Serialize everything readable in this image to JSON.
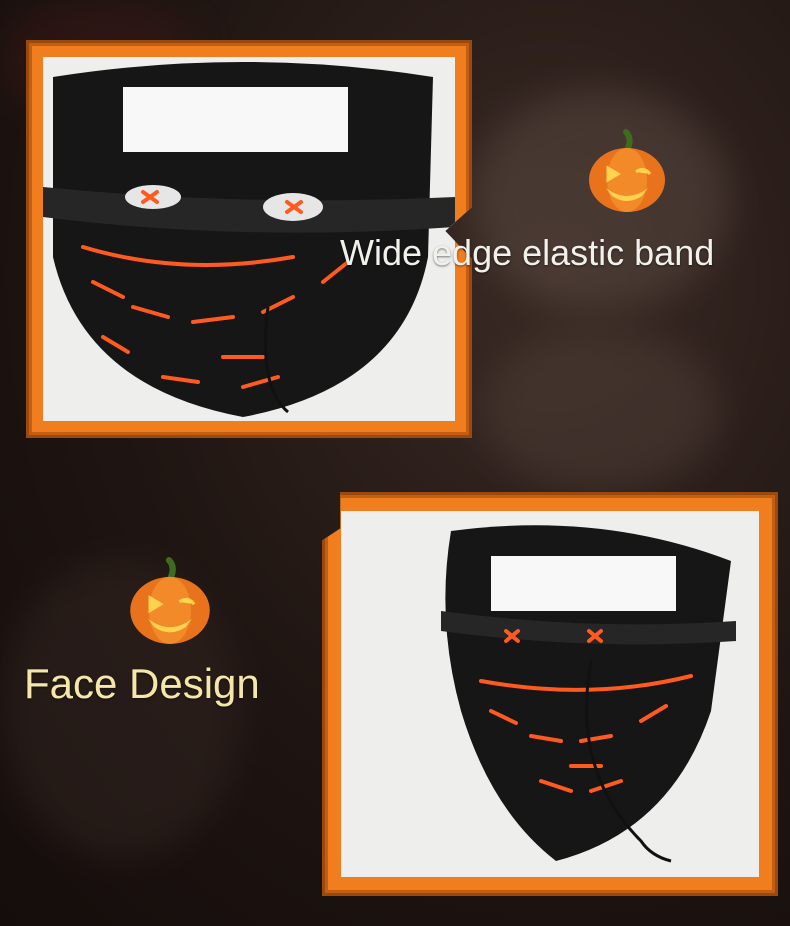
{
  "captions": {
    "band": "Wide edge elastic band",
    "face": "Face Design"
  },
  "colors": {
    "frame_orange": "#f07d1e",
    "frame_edge": "#9a4a10",
    "mask_black": "#161616",
    "wire_orange": "#ff5a1f",
    "caption_cream": "#f5e7a9"
  },
  "icons": {
    "pumpkin_top": "jack-o-lantern-icon",
    "pumpkin_left": "jack-o-lantern-icon"
  }
}
